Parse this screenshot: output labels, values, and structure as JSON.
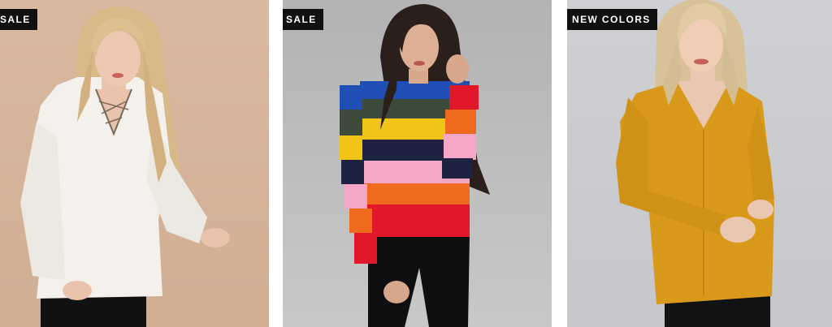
{
  "products": [
    {
      "badge": "SALE",
      "image_alt": "Model wearing white lace-up knit sweater",
      "colors": {
        "background": "#d4b39a",
        "garment": "#f4f1ec",
        "hair": "#d8b98a"
      }
    },
    {
      "badge": "SALE",
      "image_alt": "Model wearing multicolor striped sweater",
      "colors": {
        "background": "#bdbdbd",
        "garment": "multicolor-stripes",
        "hair": "#2a1f1b"
      }
    },
    {
      "badge": "NEW COLORS",
      "image_alt": "Model wearing mustard v-neck sweater",
      "colors": {
        "background": "#cbccd0",
        "garment": "#d99a1c",
        "hair": "#d8c29a"
      }
    }
  ]
}
